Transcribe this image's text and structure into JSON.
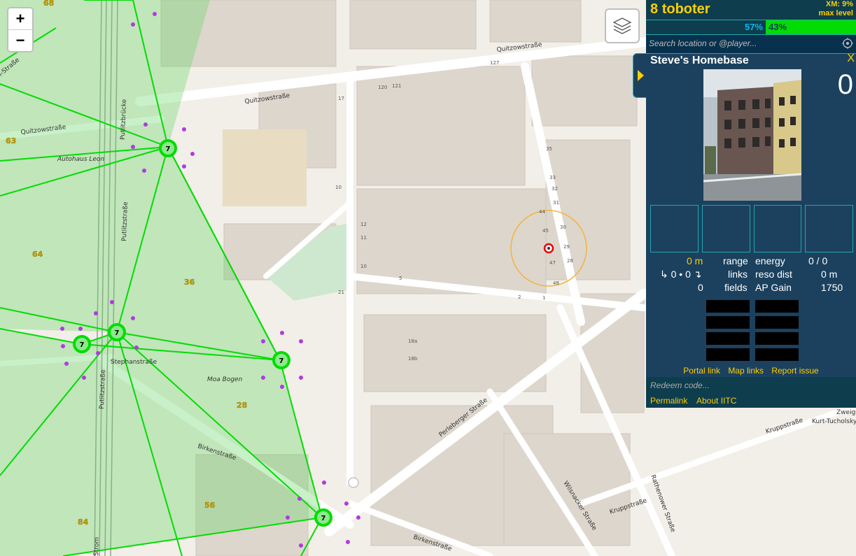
{
  "map": {
    "zoom_in": "+",
    "zoom_out": "−",
    "street_labels": {
      "quitzow_n": "Quitzowstraße",
      "quitzow_w": "Quitzowstraße",
      "quitzow_top": "Quitzowstraße",
      "putlitz_bridge": "Putlitzbrücke",
      "putlitz_str": "Putlitzstraße",
      "putlitz_str_s": "Putlitzstraße",
      "stephan": "Stephanstraße",
      "birken": "Birkenstraße",
      "birken_s": "Birkenstraße",
      "perleberger": "Perleberger Straße",
      "wilsnacker": "Wilsnacker Straße",
      "rathenower": "Rathenower Straße",
      "krupp": "Kruppstraße",
      "krupp_e": "Kruppstraße",
      "kurt": "Kurt-Tucholsky",
      "zweig": "Zweig",
      "lehrter": "ein-Straße",
      "stromstr": "Strom"
    },
    "place_labels": {
      "autohaus": "Autohaus Leon",
      "moa": "Moa Bogen"
    },
    "region_numbers": [
      "68",
      "63",
      "64",
      "36",
      "28",
      "56",
      "84"
    ],
    "portal_level_marker": "7"
  },
  "header": {
    "player_level": "8",
    "player_name": "toboter",
    "xm_label": "XM: 9%",
    "xm_level": "max level",
    "res_percent": "57%",
    "enl_percent": "43%",
    "res_fraction": 0.57,
    "colors": {
      "res": "#03baf4",
      "enl": "#03dc03",
      "accent": "#ffce00",
      "panel": "#1b415e",
      "border": "#20a8b1"
    }
  },
  "search": {
    "placeholder": "Search location or @player..."
  },
  "portal": {
    "title": "Steve's Homebase",
    "close": "X",
    "level": "0",
    "range_value": "0 m",
    "range_label": "range",
    "energy_label": "energy",
    "energy_value": "0 / 0",
    "links_value": "↳ 0 • 0 ↴",
    "links_label": "links",
    "reso_dist_label": "reso dist",
    "reso_dist_value": "0 m",
    "fields_value": "0",
    "fields_label": "fields",
    "ap_label": "AP Gain",
    "ap_value": "1750"
  },
  "links": {
    "portal_link": "Portal link",
    "map_links": "Map links",
    "report_issue": "Report issue"
  },
  "redeem": {
    "placeholder": "Redeem code..."
  },
  "footer": {
    "permalink": "Permalink",
    "about": "About IITC"
  }
}
